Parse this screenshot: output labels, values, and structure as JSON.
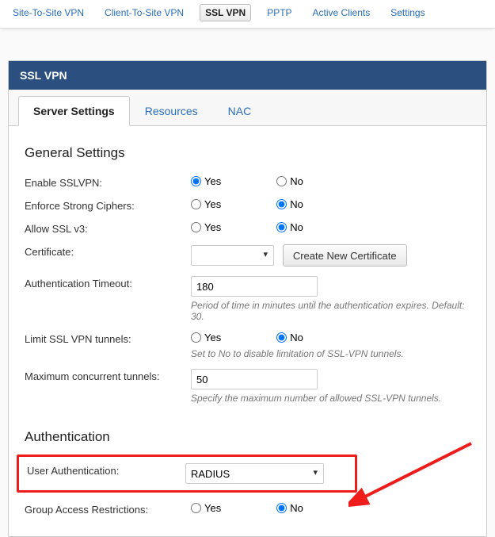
{
  "top_nav": {
    "items": [
      {
        "label": "Site-To-Site VPN"
      },
      {
        "label": "Client-To-Site VPN"
      },
      {
        "label": "SSL VPN"
      },
      {
        "label": "PPTP"
      },
      {
        "label": "Active Clients"
      },
      {
        "label": "Settings"
      }
    ],
    "active_index": 2
  },
  "panel": {
    "title": "SSL VPN",
    "tabs": [
      {
        "label": "Server Settings"
      },
      {
        "label": "Resources"
      },
      {
        "label": "NAC"
      }
    ],
    "active_tab": 0
  },
  "sections": {
    "general": {
      "heading": "General Settings",
      "enable_sslvpn": {
        "label": "Enable SSLVPN:",
        "yes": "Yes",
        "no": "No",
        "value": "Yes"
      },
      "strong_ciphers": {
        "label": "Enforce Strong Ciphers:",
        "yes": "Yes",
        "no": "No",
        "value": "No"
      },
      "allow_sslv3": {
        "label": "Allow SSL v3:",
        "yes": "Yes",
        "no": "No",
        "value": "No"
      },
      "certificate": {
        "label": "Certificate:",
        "value": "",
        "button": "Create New Certificate"
      },
      "auth_timeout": {
        "label": "Authentication Timeout:",
        "value": "180",
        "hint": "Period of time in minutes until the authentication expires. Default: 30."
      },
      "limit_tunnels": {
        "label": "Limit SSL VPN tunnels:",
        "yes": "Yes",
        "no": "No",
        "value": "No",
        "hint": "Set to No to disable limitation of SSL-VPN tunnels."
      },
      "max_tunnels": {
        "label": "Maximum concurrent tunnels:",
        "value": "50",
        "hint": "Specify the maximum number of allowed SSL-VPN tunnels."
      }
    },
    "auth": {
      "heading": "Authentication",
      "user_auth": {
        "label": "User Authentication:",
        "value": "RADIUS"
      },
      "group_restrict": {
        "label": "Group Access Restrictions:",
        "yes": "Yes",
        "no": "No",
        "value": "No"
      }
    }
  }
}
